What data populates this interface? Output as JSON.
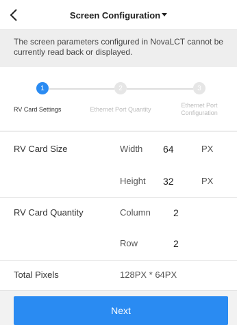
{
  "header": {
    "title": "Screen Configuration",
    "back_icon": "chevron-left-icon",
    "title_caret_icon": "caret-down-icon"
  },
  "notice": "The screen parameters configured in NovaLCT cannot be currently read back or displayed.",
  "steps": [
    {
      "number": "1",
      "label": "RV Card Settings",
      "active": true
    },
    {
      "number": "2",
      "label": "Ethernet Port Quantity",
      "active": false
    },
    {
      "number": "3",
      "label": "Ethernet Port Configuration",
      "label_lines": [
        "Ethernet Port",
        "Configuration"
      ],
      "active": false
    }
  ],
  "form": {
    "rv_card_size": {
      "label": "RV Card Size",
      "width": {
        "label": "Width",
        "value": "64",
        "unit": "PX"
      },
      "height": {
        "label": "Height",
        "value": "32",
        "unit": "PX"
      }
    },
    "rv_card_quantity": {
      "label": "RV Card Quantity",
      "column": {
        "label": "Column",
        "value": "2"
      },
      "row": {
        "label": "Row",
        "value": "2"
      }
    },
    "total_pixels": {
      "label": "Total Pixels",
      "value": "128PX * 64PX"
    }
  },
  "next_label": "Next",
  "colors": {
    "accent": "#2a8bf2",
    "background": "#eeeeee",
    "inactive_step": "#e6e6e6"
  }
}
